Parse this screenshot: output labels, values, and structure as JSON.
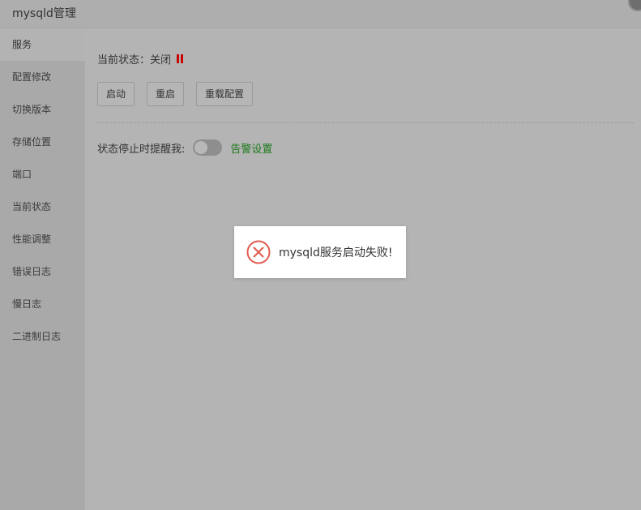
{
  "window": {
    "title": "mysqld管理"
  },
  "sidebar": {
    "items": [
      {
        "label": "服务"
      },
      {
        "label": "配置修改"
      },
      {
        "label": "切换版本"
      },
      {
        "label": "存储位置"
      },
      {
        "label": "端口"
      },
      {
        "label": "当前状态"
      },
      {
        "label": "性能调整"
      },
      {
        "label": "错误日志"
      },
      {
        "label": "慢日志"
      },
      {
        "label": "二进制日志"
      }
    ],
    "active_index": 0
  },
  "main": {
    "status_label": "当前状态：",
    "status_value": "关闭",
    "buttons": {
      "start": "启动",
      "restart": "重启",
      "reload": "重载配置"
    },
    "alert_label": "状态停止时提醒我:",
    "alert_toggle": false,
    "alert_settings_link": "告警设置"
  },
  "toast": {
    "message": "mysqld服务启动失败!",
    "icon": "error-circle-x-icon"
  },
  "colors": {
    "status_red": "#c80000",
    "link_green": "#1e7a1e",
    "error_red": "#e05a4e"
  }
}
